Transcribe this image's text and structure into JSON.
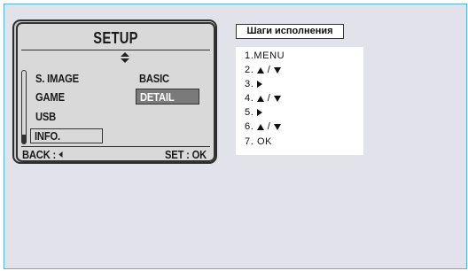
{
  "camera_screen": {
    "title": "SETUP",
    "menu_items": [
      {
        "label": "S. IMAGE"
      },
      {
        "label": "GAME"
      },
      {
        "label": "USB"
      },
      {
        "label": "INFO."
      }
    ],
    "options": [
      {
        "label": "BASIC"
      },
      {
        "label": "DETAIL"
      }
    ],
    "footer_left": "BACK : ",
    "footer_left_icon": "left-arrow-icon",
    "footer_right": "SET : OK"
  },
  "steps": {
    "header": "Шаги исполнения",
    "items": [
      {
        "prefix": "1.MENU",
        "icons": []
      },
      {
        "prefix": "2. ",
        "icons": [
          "up-triangle-icon",
          "down-triangle-icon"
        ]
      },
      {
        "prefix": "3. ",
        "icons": [
          "right-triangle-icon"
        ]
      },
      {
        "prefix": "4. ",
        "icons": [
          "up-triangle-icon",
          "down-triangle-icon"
        ]
      },
      {
        "prefix": "5. ",
        "icons": [
          "right-triangle-icon"
        ]
      },
      {
        "prefix": "6. ",
        "icons": [
          "up-triangle-icon",
          "down-triangle-icon"
        ]
      },
      {
        "prefix": "7. OK",
        "icons": []
      }
    ],
    "separator": "/"
  }
}
